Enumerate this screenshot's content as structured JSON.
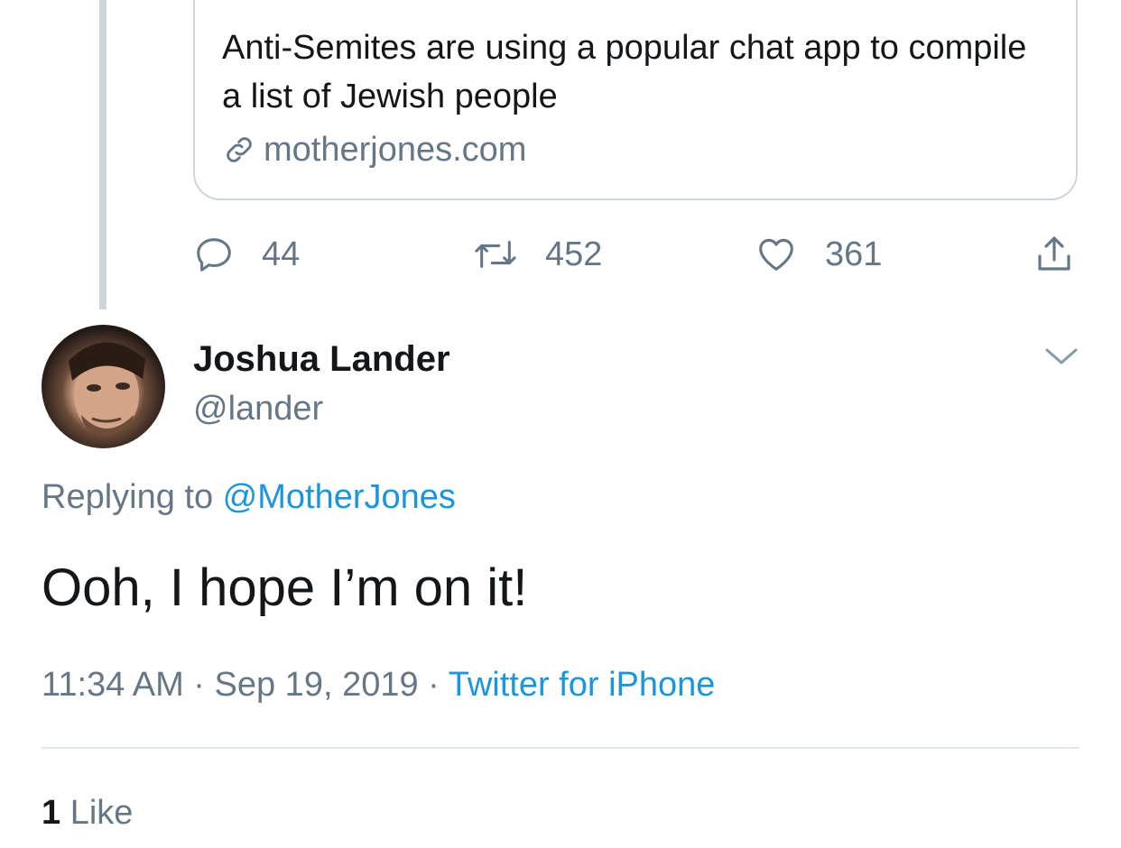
{
  "card": {
    "title": "Anti-Semites are using a popular chat app to compile a list of Jewish people",
    "domain": "motherjones.com"
  },
  "actions": {
    "reply_count": "44",
    "retweet_count": "452",
    "like_count": "361"
  },
  "author": {
    "name": "Joshua Lander",
    "handle": "@lander"
  },
  "replying": {
    "prefix": "Replying to ",
    "mention": "@MotherJones"
  },
  "tweet": {
    "text": "Ooh, I hope I’m on it!",
    "time": "11:34 AM",
    "separator1": " · ",
    "date": "Sep 19, 2019",
    "separator2": " · ",
    "source": "Twitter for iPhone"
  },
  "stats": {
    "likes_num": "1",
    "likes_label": " Like"
  },
  "colors": {
    "link": "#1b95e0",
    "secondary": "#657786",
    "border": "#ccd6dd"
  }
}
